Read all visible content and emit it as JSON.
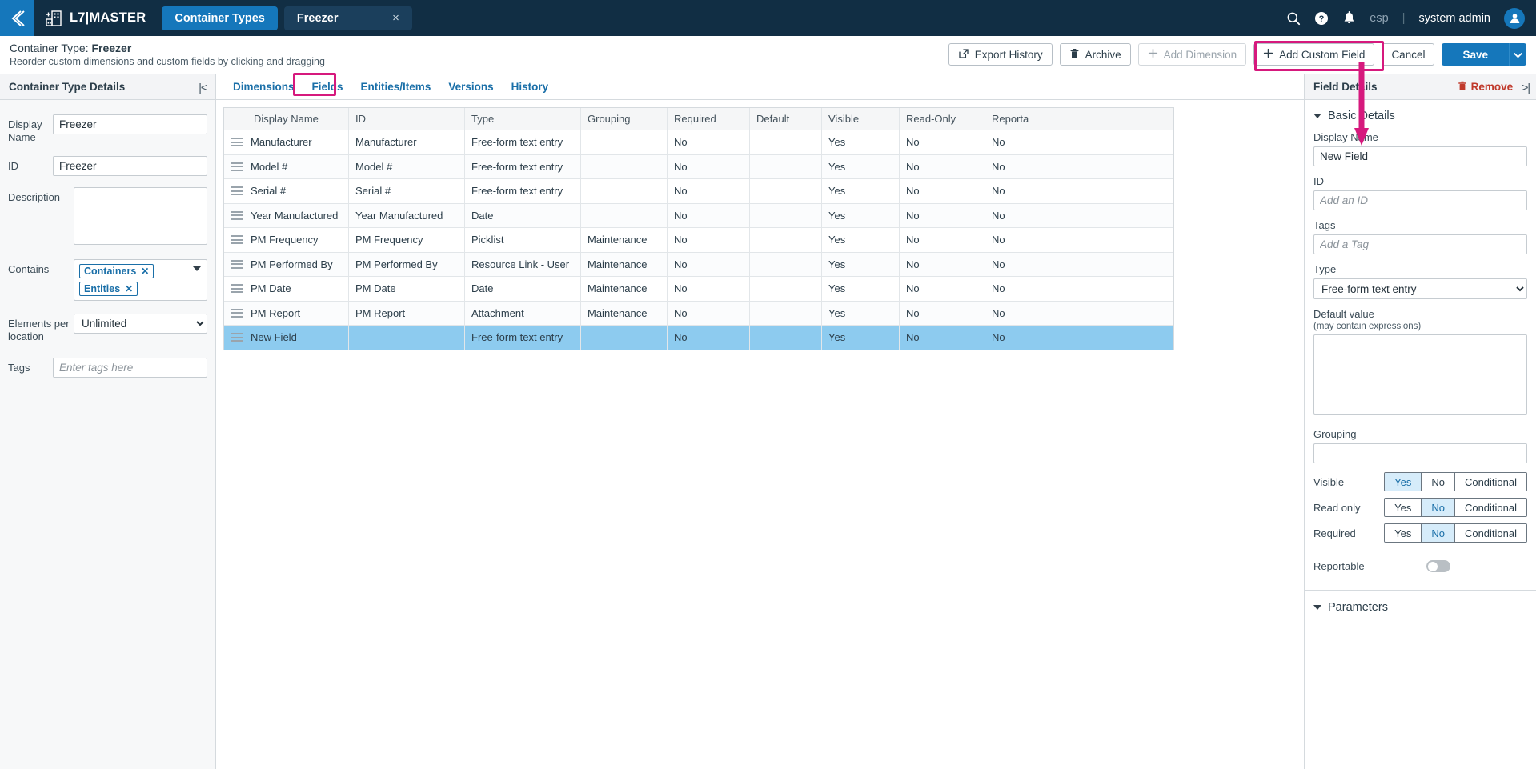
{
  "topbar": {
    "back_icon": "back-chevron-icon",
    "brand_logo_icon": "building-add-icon",
    "brand_name": "L7|MASTER",
    "tabs": [
      {
        "label": "Container Types",
        "type": "primary"
      },
      {
        "label": "Freezer",
        "type": "doc",
        "close": "×"
      }
    ],
    "search_icon": "search-icon",
    "help_icon": "help-circle-icon",
    "bell_icon": "bell-icon",
    "lang": "esp",
    "divider": "|",
    "username": "system admin",
    "avatar_icon": "user-avatar-icon"
  },
  "pagehead": {
    "title_prefix": "Container Type: ",
    "title_value": "Freezer",
    "subtitle": "Reorder custom dimensions and custom fields by clicking and dragging",
    "buttons": {
      "export_history": "Export History",
      "archive": "Archive",
      "add_dimension": "Add Dimension",
      "add_custom_field": "Add Custom Field",
      "cancel": "Cancel",
      "save": "Save"
    },
    "icons": {
      "export": "external-link-icon",
      "archive": "trash-icon",
      "plus": "plus-icon",
      "save_caret": "chevron-down-icon"
    },
    "highlight_color": "#d6197d"
  },
  "left_panel": {
    "title": "Container Type Details",
    "collapse_icon": "collapse-left-icon",
    "fields": {
      "display_name_label": "Display Name",
      "display_name_value": "Freezer",
      "id_label": "ID",
      "id_value": "Freezer",
      "description_label": "Description",
      "description_value": "",
      "contains_label": "Contains",
      "contains_chips": [
        "Containers",
        "Entities"
      ],
      "chip_remove": "✕",
      "elements_label": "Elements per location",
      "elements_value": "Unlimited",
      "tags_label": "Tags",
      "tags_placeholder": "Enter tags here",
      "tags_value": ""
    }
  },
  "center": {
    "tabs": [
      {
        "label": "Dimensions",
        "active": false
      },
      {
        "label": "Fields",
        "active": true
      },
      {
        "label": "Entities/Items",
        "active": false
      },
      {
        "label": "Versions",
        "active": false
      },
      {
        "label": "History",
        "active": false
      }
    ],
    "table": {
      "columns": [
        "Display Name",
        "ID",
        "Type",
        "Grouping",
        "Required",
        "Default",
        "Visible",
        "Read-Only",
        "Reporta"
      ],
      "rows": [
        {
          "display_name": "Manufacturer",
          "id": "Manufacturer",
          "type": "Free-form text entry",
          "grouping": "",
          "required": "No",
          "default": "",
          "visible": "Yes",
          "read_only": "No",
          "reportable": "No",
          "selected": false
        },
        {
          "display_name": "Model #",
          "id": "Model #",
          "type": "Free-form text entry",
          "grouping": "",
          "required": "No",
          "default": "",
          "visible": "Yes",
          "read_only": "No",
          "reportable": "No",
          "selected": false
        },
        {
          "display_name": "Serial #",
          "id": "Serial #",
          "type": "Free-form text entry",
          "grouping": "",
          "required": "No",
          "default": "",
          "visible": "Yes",
          "read_only": "No",
          "reportable": "No",
          "selected": false
        },
        {
          "display_name": "Year Manufactured",
          "id": "Year Manufactured",
          "type": "Date",
          "grouping": "",
          "required": "No",
          "default": "",
          "visible": "Yes",
          "read_only": "No",
          "reportable": "No",
          "selected": false
        },
        {
          "display_name": "PM Frequency",
          "id": "PM Frequency",
          "type": "Picklist",
          "grouping": "Maintenance",
          "required": "No",
          "default": "",
          "visible": "Yes",
          "read_only": "No",
          "reportable": "No",
          "selected": false
        },
        {
          "display_name": "PM Performed By",
          "id": "PM Performed By",
          "type": "Resource Link - User",
          "grouping": "Maintenance",
          "required": "No",
          "default": "",
          "visible": "Yes",
          "read_only": "No",
          "reportable": "No",
          "selected": false
        },
        {
          "display_name": "PM Date",
          "id": "PM Date",
          "type": "Date",
          "grouping": "Maintenance",
          "required": "No",
          "default": "",
          "visible": "Yes",
          "read_only": "No",
          "reportable": "No",
          "selected": false
        },
        {
          "display_name": "PM Report",
          "id": "PM Report",
          "type": "Attachment",
          "grouping": "Maintenance",
          "required": "No",
          "default": "",
          "visible": "Yes",
          "read_only": "No",
          "reportable": "No",
          "selected": false
        },
        {
          "display_name": "New Field",
          "id": "",
          "type": "Free-form text entry",
          "grouping": "",
          "required": "No",
          "default": "",
          "visible": "Yes",
          "read_only": "No",
          "reportable": "No",
          "selected": true
        }
      ]
    }
  },
  "right_panel": {
    "title": "Field Details",
    "remove_label": "Remove",
    "remove_icon": "trash-icon",
    "expand_icon": "collapse-right-icon",
    "basic_details": "Basic Details",
    "display_name_label": "Display Name",
    "display_name_value": "New Field",
    "id_label": "ID",
    "id_placeholder": "Add an ID",
    "id_value": "",
    "tags_label": "Tags",
    "tags_placeholder": "Add a Tag",
    "tags_value": "",
    "type_label": "Type",
    "type_value": "Free-form text entry",
    "default_label": "Default value",
    "default_sub": "(may contain expressions)",
    "default_value": "",
    "grouping_label": "Grouping",
    "grouping_value": "",
    "segments": [
      {
        "label": "Visible",
        "options": [
          "Yes",
          "No",
          "Conditional"
        ],
        "selected": "Yes"
      },
      {
        "label": "Read only",
        "options": [
          "Yes",
          "No",
          "Conditional"
        ],
        "selected": "No"
      },
      {
        "label": "Required",
        "options": [
          "Yes",
          "No",
          "Conditional"
        ],
        "selected": "No"
      }
    ],
    "reportable_label": "Reportable",
    "reportable_on": false,
    "parameters": "Parameters"
  }
}
